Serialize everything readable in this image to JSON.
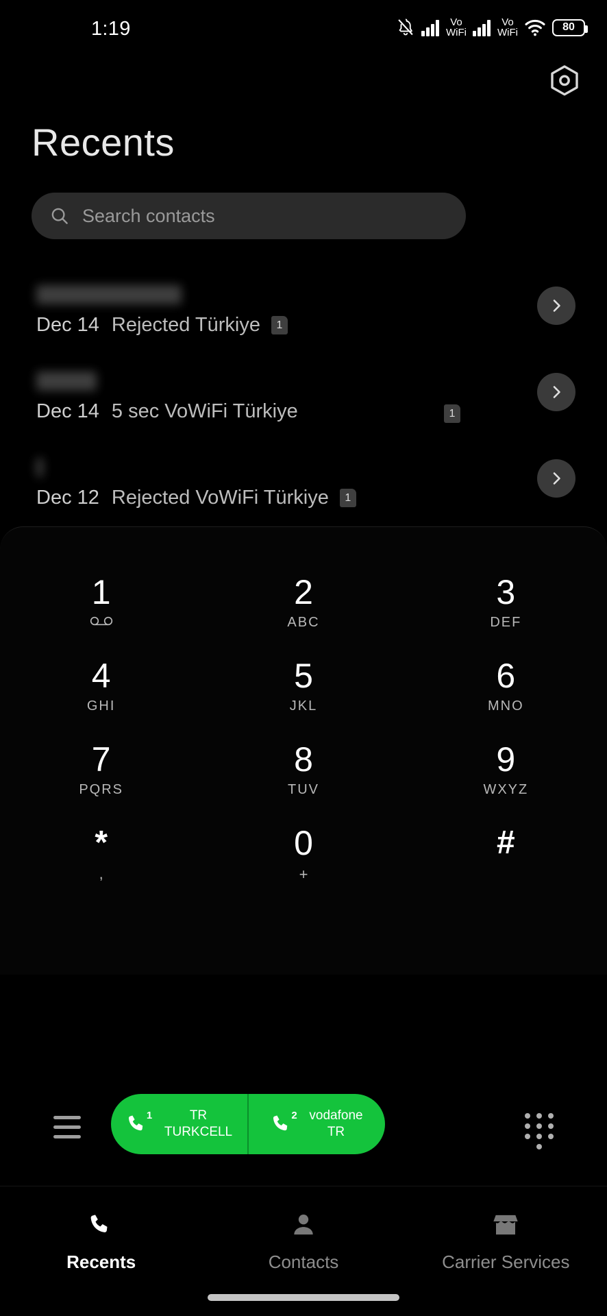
{
  "statusbar": {
    "time": "1:19",
    "battery_level": "80",
    "sim1_network": "Vo",
    "sim1_network2": "WiFi",
    "sim2_network": "Vo",
    "sim2_network2": "WiFi",
    "icons": [
      "ringer-off-icon",
      "signal-bars-icon",
      "vowifi-icon",
      "signal-bars-icon",
      "vowifi-icon",
      "wifi-icon",
      "battery-icon"
    ]
  },
  "header": {
    "title": "Recents",
    "settings_icon": "hexagon-settings-icon"
  },
  "search": {
    "placeholder": "Search contacts",
    "value": "",
    "icon": "search-icon"
  },
  "calls": [
    {
      "name": "",
      "name_redacted": true,
      "name_width": 212,
      "date": "Dec 14",
      "detail": "Rejected Türkiye",
      "sim": "1",
      "sim_far": false,
      "chevron": "chevron-right-icon"
    },
    {
      "name": "",
      "name_redacted": true,
      "name_width": 88,
      "date": "Dec 14",
      "detail": "5 sec VoWiFi Türkiye",
      "sim": "1",
      "sim_far": true,
      "chevron": "chevron-right-icon"
    },
    {
      "name": "",
      "name_redacted": true,
      "name_width": 10,
      "date": "Dec 12",
      "detail": "Rejected VoWiFi Türkiye",
      "sim": "1",
      "sim_far": false,
      "chevron": "chevron-right-icon"
    }
  ],
  "dialpad": {
    "keys": [
      {
        "digit": "1",
        "sub": "",
        "sub_icon": "voicemail-icon"
      },
      {
        "digit": "2",
        "sub": "ABC",
        "sub_icon": ""
      },
      {
        "digit": "3",
        "sub": "DEF",
        "sub_icon": ""
      },
      {
        "digit": "4",
        "sub": "GHI",
        "sub_icon": ""
      },
      {
        "digit": "5",
        "sub": "JKL",
        "sub_icon": ""
      },
      {
        "digit": "6",
        "sub": "MNO",
        "sub_icon": ""
      },
      {
        "digit": "7",
        "sub": "PQRS",
        "sub_icon": ""
      },
      {
        "digit": "8",
        "sub": "TUV",
        "sub_icon": ""
      },
      {
        "digit": "9",
        "sub": "WXYZ",
        "sub_icon": ""
      },
      {
        "digit": "*",
        "sub": ",",
        "sub_icon": ""
      },
      {
        "digit": "0",
        "sub": "+",
        "sub_icon": ""
      },
      {
        "digit": "#",
        "sub": "",
        "sub_icon": ""
      }
    ]
  },
  "actionbar": {
    "menu_icon": "hamburger-menu-icon",
    "keypad_icon": "dialpad-dots-icon",
    "call_button_color": "#14c33c",
    "sim1": {
      "num": "1",
      "line1": "TR",
      "line2": "TURKCELL",
      "icon": "phone-call-icon"
    },
    "sim2": {
      "num": "2",
      "line1": "vodafone",
      "line2": "TR",
      "icon": "phone-call-icon"
    }
  },
  "bottomnav": {
    "items": [
      {
        "label": "Recents",
        "icon": "phone-icon",
        "active": true
      },
      {
        "label": "Contacts",
        "icon": "person-icon",
        "active": false
      },
      {
        "label": "Carrier Services",
        "icon": "store-icon",
        "active": false
      }
    ]
  }
}
